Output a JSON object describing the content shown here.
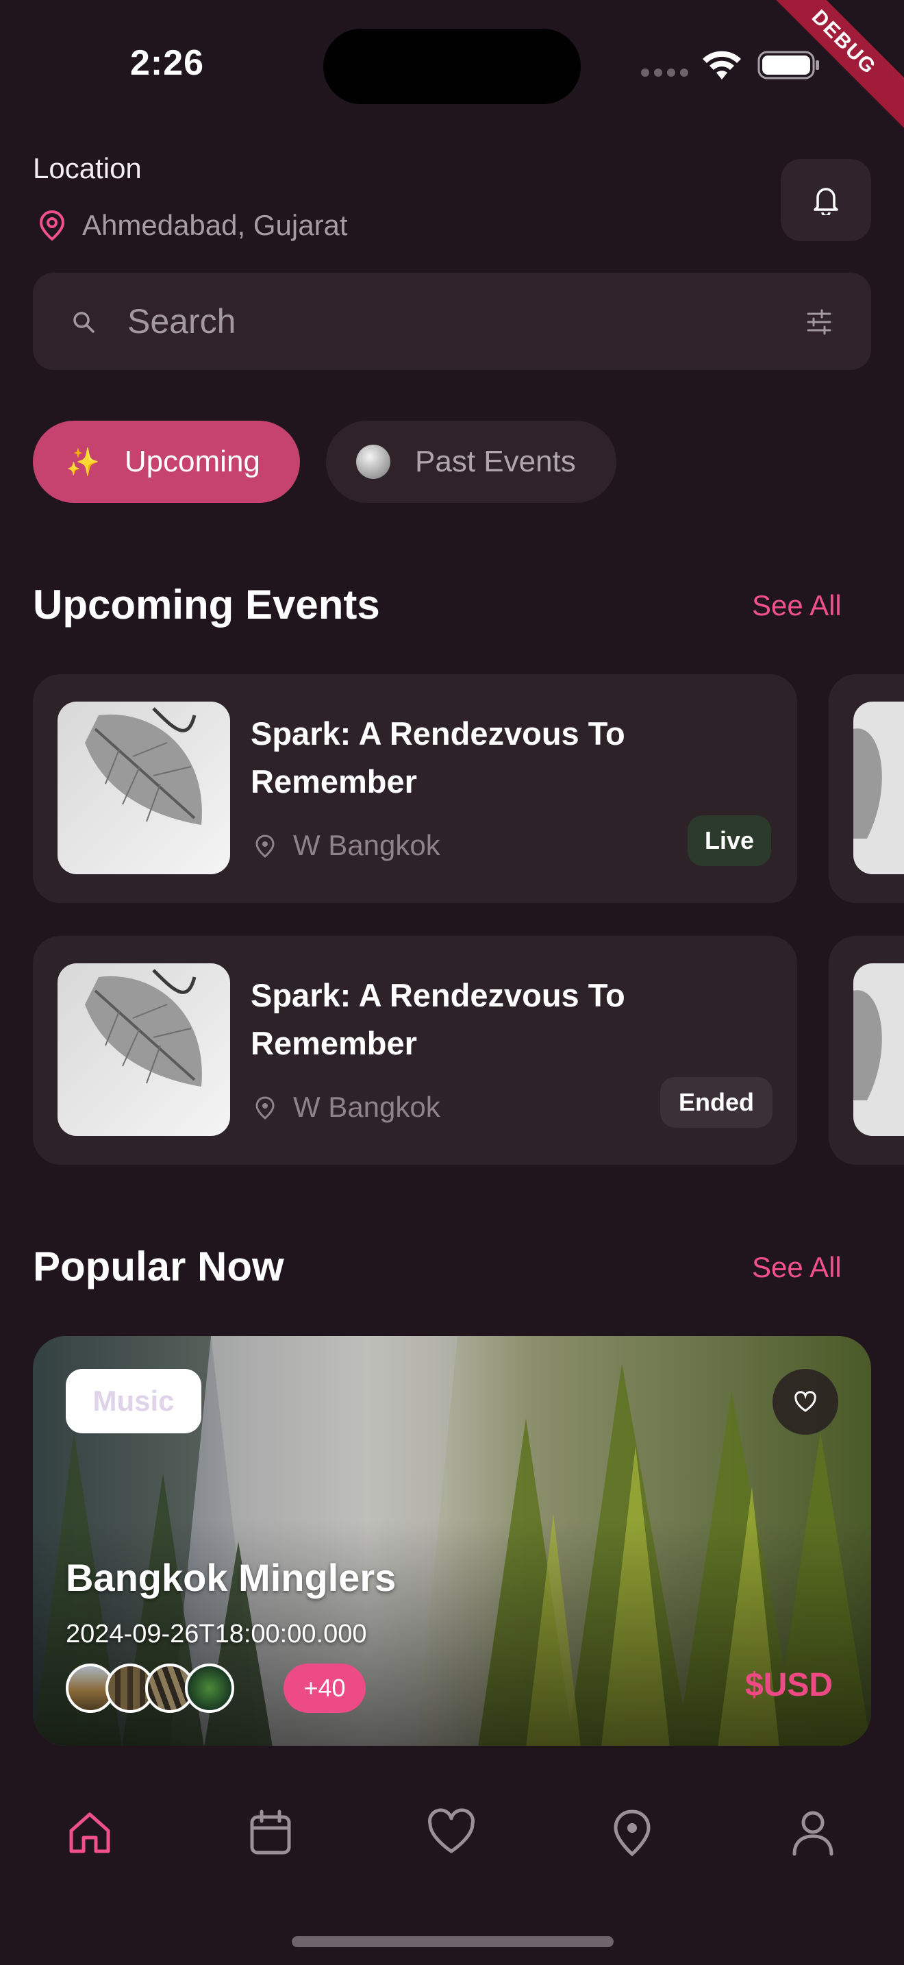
{
  "status_bar": {
    "time": "2:26",
    "debug_label": "DEBUG"
  },
  "header": {
    "location_label": "Location",
    "location_value": "Ahmedabad, Gujarat"
  },
  "search": {
    "placeholder": "Search"
  },
  "chips": [
    {
      "emoji": "✨",
      "label": "Upcoming"
    },
    {
      "label": "Past Events"
    }
  ],
  "upcoming": {
    "title": "Upcoming Events",
    "see_all": "See All",
    "events": [
      {
        "title": "Spark: A Rendezvous To Remember",
        "venue": "W Bangkok",
        "status": "Live"
      },
      {
        "title": "Spark: A Rendezvous To Remember",
        "venue": "W Bangkok",
        "status": "Ended"
      }
    ]
  },
  "popular": {
    "title": "Popular Now",
    "see_all": "See All",
    "card": {
      "tag": "Music",
      "title": "Bangkok Minglers",
      "date": "2024-09-26T18:00:00.000",
      "attendees_extra": "+40",
      "price": "$USD"
    }
  },
  "bottom_nav": [
    "home-icon",
    "calendar-icon",
    "heart-icon",
    "map-pin-icon",
    "profile-icon"
  ],
  "colors": {
    "background": "#21151d",
    "accent": "#f0508c",
    "chip_active": "#c6426f",
    "card": "#2e2229"
  }
}
